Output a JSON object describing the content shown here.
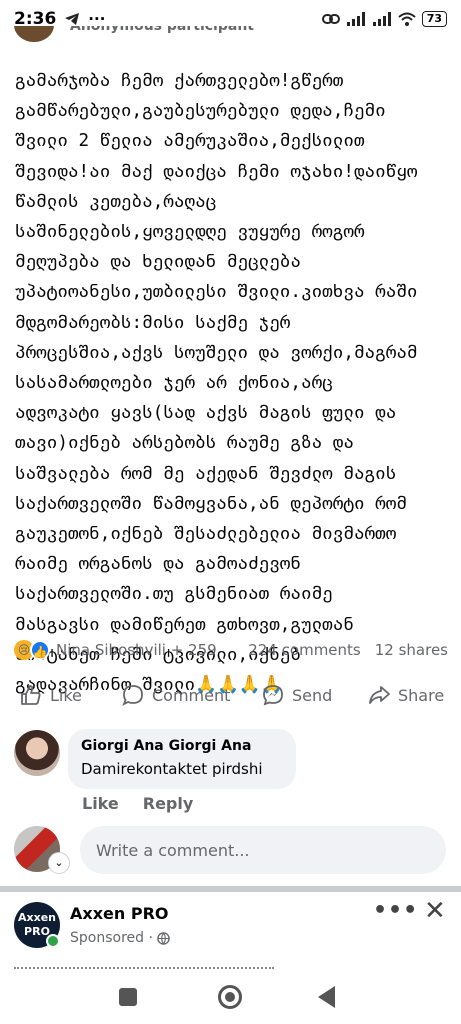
{
  "status_bar": {
    "time": "2:36",
    "telegram_icon": "telegram-icon",
    "more": "···",
    "battery": "73"
  },
  "post": {
    "header_author": "Anonymous participant",
    "body": "გამარჯობა ჩემო ქართველებო!გწერთ\nგამწარებული,გაუბესურებული დედა,ჩემი\nშვილი 2 წელია ამერუკაშია,მექსილით\nშევიდა!აი მაქ დაიქცა ჩემი ოჯახი!დაიწყო\nწამლის კეთება,რაღაც\nსაშინელების,ყოველდღე ვუყურე როგორ\nმეღუპება და ხელიდან მეცლება\nუპატიოანესი,უთბილესი შვილი.კითხვა რაში\nმდგომარეობს:მისი საქმე ჯერ\nპროცესშია,აქვს სოუშელი და ვორქი,მაგრამ\nსასამართლოები ჯერ არ ქონია,არც\nადვოკატი ყავს(სად აქვს მაგის ფული და\nთავი)იქნებ არსებობს რაუმე გზა და\nსაშვალება რომ მე აქედან შევძლო მაგის\nსაქართველოში წამოყვანა,ან დეპორტი რომ\nგაუკეთონ,იქნებ შესაძლებელია მივმართო\nრაიმე ორგანოს და გამოაძევონ\nსაქართველოში.თუ გსმენიათ რაიმე\nმასგავსი დამიწერეთ გთხოვთ,გულთან\nმიიტანეთ ჩემი ტკივილი,იქნებ\nგადავარჩინო შვილი🙏🙏🙏🙏",
    "reactions_names": "Nina Siboshvili + 259",
    "comments_count": "224 comments",
    "shares_count": "12 shares"
  },
  "actions": {
    "like": "Like",
    "comment": "Comment",
    "send": "Send",
    "share": "Share"
  },
  "comment": {
    "author": "Giorgi Ana Giorgi Ana",
    "text": "Damirekontaktet pirdshi",
    "like": "Like",
    "reply": "Reply"
  },
  "composer": {
    "placeholder": "Write a comment..."
  },
  "ad": {
    "avatar_text_1": "Axxen",
    "avatar_text_2": "PRO",
    "name": "Axxen PRO",
    "sponsored": "Sponsored ·"
  },
  "colors": {
    "accent": "#1877f2",
    "muted": "#65676b",
    "bubble": "#f0f2f5"
  }
}
